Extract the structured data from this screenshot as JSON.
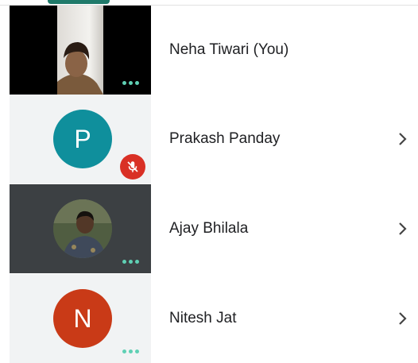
{
  "colors": {
    "accent": "#1f7a6a",
    "dots": "#5fd0b4",
    "tile_light": "#f1f3f4",
    "tile_dark": "#3c4043",
    "avatar_p": "#0f8f9c",
    "avatar_n": "#c93a17",
    "muted": "#d93025"
  },
  "participants": [
    {
      "name": "Neha Tiwari (You)",
      "tile": "video",
      "has_chevron": false,
      "indicator": "more-dots"
    },
    {
      "name": "Prakash Panday",
      "tile": "letter",
      "initial": "P",
      "has_chevron": true,
      "indicator": "mic-off-icon"
    },
    {
      "name": "Ajay Bhilala",
      "tile": "photo",
      "has_chevron": true,
      "indicator": "more-dots"
    },
    {
      "name": "Nitesh Jat",
      "tile": "letter",
      "initial": "N",
      "has_chevron": true,
      "indicator": "more-dots"
    }
  ]
}
